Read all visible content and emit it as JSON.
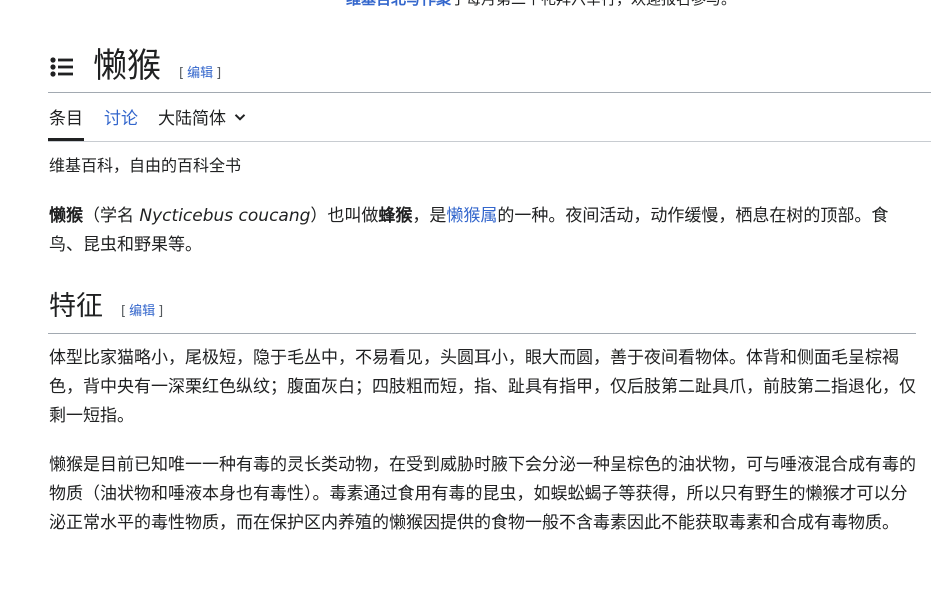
{
  "banner": {
    "link_text": "维基百北写作聚",
    "rest_text": "于每月第二个礼拜六举行，欢迎报名参与。"
  },
  "title": {
    "text": "懒猴",
    "edit_open": "[",
    "edit_label": "编辑",
    "edit_close": "]"
  },
  "tabs": {
    "article": "条目",
    "talk": "讨论",
    "variant": "大陆简体"
  },
  "tagline": "维基百科，自由的百科全书",
  "intro": {
    "bold_name": "懒猴",
    "sci_prefix": "（学名 ",
    "sci_name": "Nycticebus coucang",
    "sci_suffix": "）也叫做",
    "bold_alias": "蜂猴",
    "mid": "，是",
    "genus_link": "懒猴属",
    "rest": "的一种。夜间活动，动作缓慢，栖息在树的顶部。食鸟、昆虫和野果等。"
  },
  "section": {
    "title": "特征",
    "edit_open": "[",
    "edit_label": "编辑",
    "edit_close": "]"
  },
  "paragraphs": {
    "features": "体型比家猫略小，尾极短，隐于毛丛中，不易看见，头圆耳小，眼大而圆，善于夜间看物体。体背和侧面毛呈棕褐色，背中央有一深栗红色纵纹；腹面灰白；四肢粗而短，指、趾具有指甲，仅后肢第二趾具爪，前肢第二指退化，仅剩一短指。",
    "venom": "懒猴是目前已知唯一一种有毒的灵长类动物，在受到威胁时腋下会分泌一种呈棕色的油状物，可与唾液混合成有毒的物质（油状物和唾液本身也有毒性）。毒素通过食用有毒的昆虫，如蜈蚣蝎子等获得，所以只有野生的懒猴才可以分泌正常水平的毒性物质，而在保护区内养殖的懒猴因提供的食物一般不含毒素因此不能获取毒素和合成有毒物质。"
  },
  "icons": {
    "toc": "list-icon",
    "variant": "chevron-down-icon"
  },
  "colors": {
    "link": "#3366cc",
    "text": "#202122",
    "rule": "#a2a9b1"
  }
}
